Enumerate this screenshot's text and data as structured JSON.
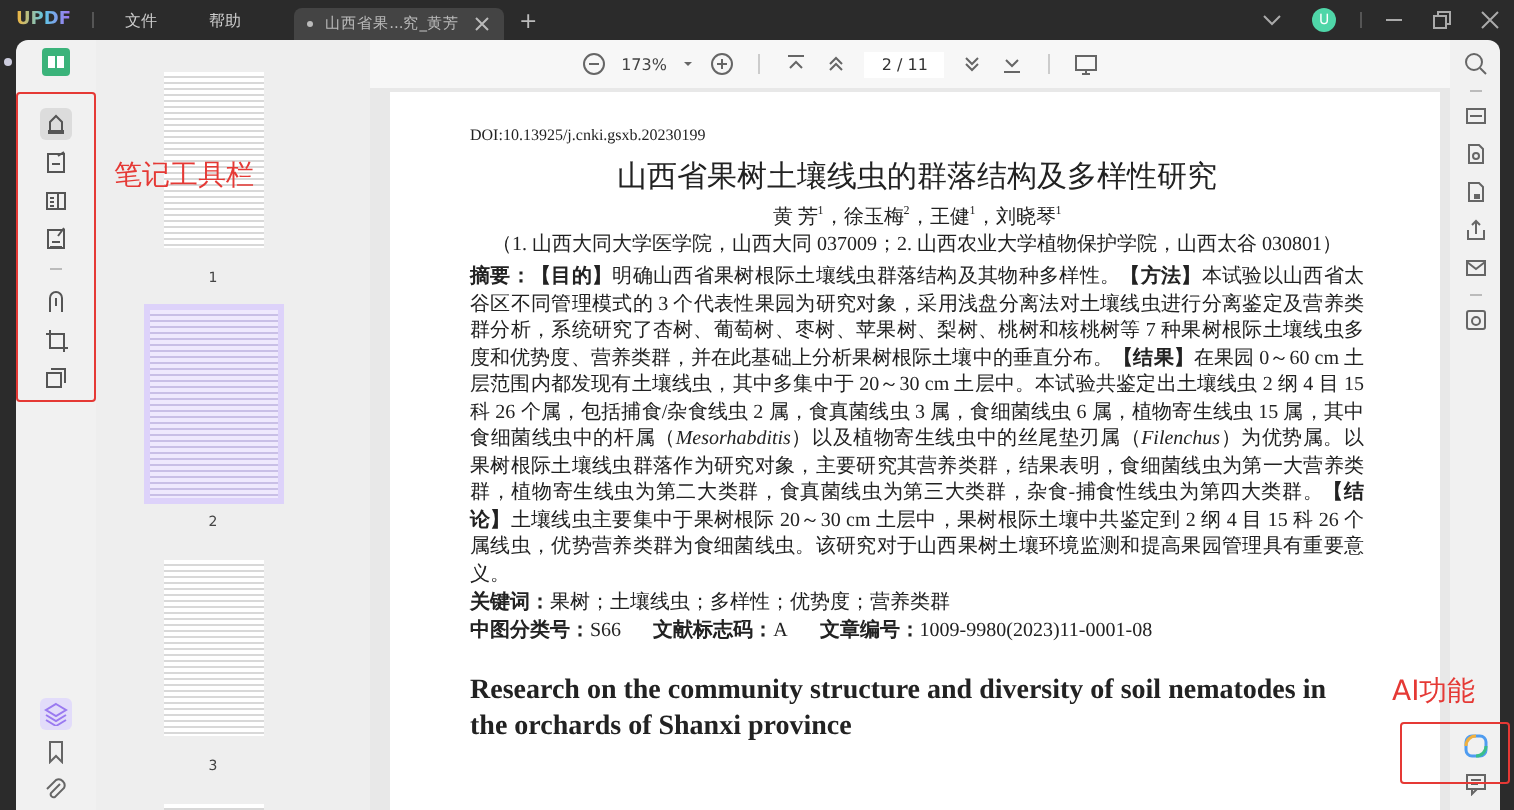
{
  "titlebar": {
    "logo": "UPDF",
    "menus": [
      "文件",
      "帮助"
    ],
    "tabs": [
      {
        "label": "山西省果...究_黄芳",
        "selected": true
      }
    ],
    "new_tab": "+",
    "avatar": "U"
  },
  "toolbar": {
    "zoom": "173%",
    "page": "2 / 11"
  },
  "left_tools": [
    {
      "selected": true
    },
    {
      "selected": false
    },
    {
      "selected": false
    },
    {
      "selected": false
    },
    {
      "selected": false
    },
    {
      "selected": false
    },
    {
      "selected": false
    }
  ],
  "sidebar_bottom": [
    {
      "selected": true
    },
    {
      "selected": false
    },
    {
      "selected": false
    }
  ],
  "thumbnails": [
    {
      "label": "1",
      "selected": false
    },
    {
      "label": "2",
      "selected": true
    },
    {
      "label": "3",
      "selected": false
    },
    {
      "selected": false
    }
  ],
  "document": {
    "doi": "DOI:10.13925/j.cnki.gsxb.20230199",
    "title": "山西省果树土壤线虫的群落结构及多样性研究",
    "authors": "黄 芳$^{1}$，徐玉梅$^{2}$，王健$^{1}$，刘晓琴$^{1}$",
    "affiliation": "（1. 山西大同大学医学院，山西大同 037009；2. 山西农业大学植物保护学院，山西太谷 030801）",
    "abstract": "**摘要：【目的】**明确山西省果树根际土壤线虫群落结构及其物种多样性。**【方法】**本试验以山西省太谷区不同管理模式的 3 个代表性果园为研究对象，采用浅盘分离法对土壤线虫进行分离鉴定及营养类群分析，系统研究了杏树、葡萄树、枣树、苹果树、梨树、桃树和核桃树等 7 种果树根际土壤线虫多度和优势度、营养类群，并在此基础上分析果树根际土壤中的垂直分布。**【结果】**在果园 0～60 cm 土层范围内都发现有土壤线虫，其中多集中于 20～30 cm 土层中。本试验共鉴定出土壤线虫 2 纲 4 目 15 科 26 个属，包括捕食/杂食线虫 2 属，食真菌线虫 3 属，食细菌线虫 6 属，植物寄生线虫 15 属，其中食细菌线虫中的杆属（*Mesorhabditis*）以及植物寄生线虫中的丝尾垫刃属（*Filenchus*）为优势属。以果树根际土壤线虫群落作为研究对象，主要研究其营养类群，结果表明，食细菌线虫为第一大营养类群，植物寄生线虫为第二大类群，食真菌线虫为第三大类群，杂食-捕食性线虫为第四大类群。**【结论】**土壤线虫主要集中于果树根际 20～30 cm 土层中，果树根际土壤中共鉴定到 2 纲 4 目 15 科 26 个属线虫，优势营养类群为食细菌线虫。该研究对于山西果树土壤环境监测和提高果园管理具有重要意义。",
    "keywords": "**关键词：**果树；土壤线虫；多样性；优势度；营养类群",
    "classification": [
      "**中图分类号：**S66",
      "**文献标志码：**A",
      "**文章编号：**1009-9980(2023)11-0001-08"
    ],
    "english_title": "Research on the community structure and diversity of soil nematodes in the orchards of Shanxi province"
  },
  "annotations": [
    {
      "kind": "left",
      "text": "笔记工具栏"
    },
    {
      "kind": "right",
      "text": "AI功能"
    }
  ]
}
